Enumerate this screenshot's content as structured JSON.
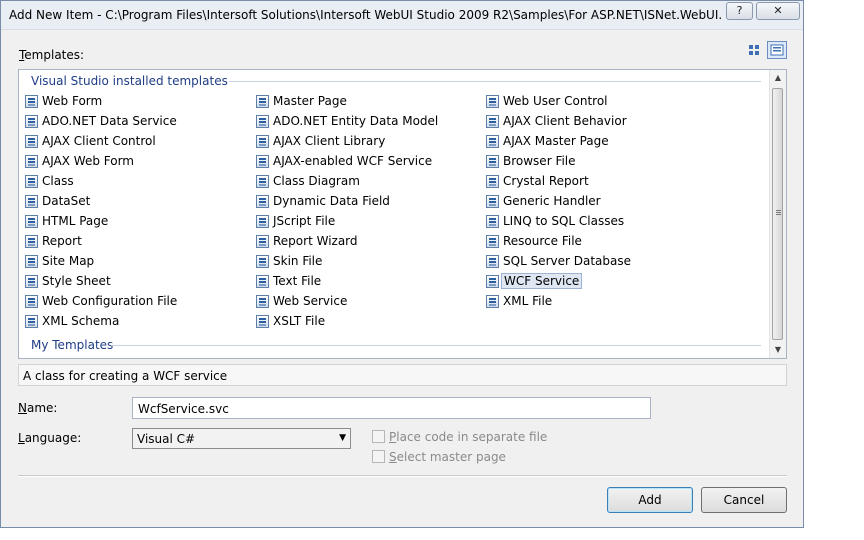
{
  "window": {
    "title": "Add New Item - C:\\Program Files\\Intersoft Solutions\\Intersoft WebUI Studio 2009 R2\\Samples\\For ASP.NET\\ISNet.WebUI.Samples\\c...",
    "help_label": "?",
    "close_label": "✕"
  },
  "templates_label": "Templates:",
  "templates_label_access": "T",
  "templates_label_rest": "emplates:",
  "view_buttons": [
    {
      "name": "small-icons-view",
      "icon": "grid-icon"
    },
    {
      "name": "medium-icons-view",
      "icon": "list-view-icon",
      "selected": true
    }
  ],
  "groups": {
    "installed": "Visual Studio installed templates",
    "my": "My Templates"
  },
  "columns": [
    [
      "Web Form",
      "ADO.NET Data Service",
      "AJAX Client Control",
      "AJAX Web Form",
      "Class",
      "DataSet",
      "HTML Page",
      "Report",
      "Site Map",
      "Style Sheet",
      "Web Configuration File",
      "XML Schema"
    ],
    [
      "Master Page",
      "ADO.NET Entity Data Model",
      "AJAX Client Library",
      "AJAX-enabled WCF Service",
      "Class Diagram",
      "Dynamic Data Field",
      "JScript File",
      "Report Wizard",
      "Skin File",
      "Text File",
      "Web Service",
      "XSLT File"
    ],
    [
      "Web User Control",
      "AJAX Client Behavior",
      "AJAX Master Page",
      "Browser File",
      "Crystal Report",
      "Generic Handler",
      "LINQ to SQL Classes",
      "Resource File",
      "SQL Server Database",
      "WCF Service",
      "XML File"
    ]
  ],
  "selected_template": "WCF Service",
  "description": "A class for creating a WCF service",
  "name_field": {
    "label": "Name:",
    "access": "N",
    "rest": "ame:",
    "value": "WcfService.svc"
  },
  "language_field": {
    "label": "Language:",
    "access": "L",
    "rest": "anguage:",
    "value": "Visual C#"
  },
  "options": {
    "place_code": {
      "label": "Place code in separate file",
      "access": "P",
      "rest": "lace code in separate file",
      "checked": false,
      "enabled": false
    },
    "select_master": {
      "label": "Select master page",
      "access": "S",
      "rest": "elect master page",
      "checked": false,
      "enabled": false
    }
  },
  "buttons": {
    "add": "Add",
    "cancel": "Cancel"
  }
}
